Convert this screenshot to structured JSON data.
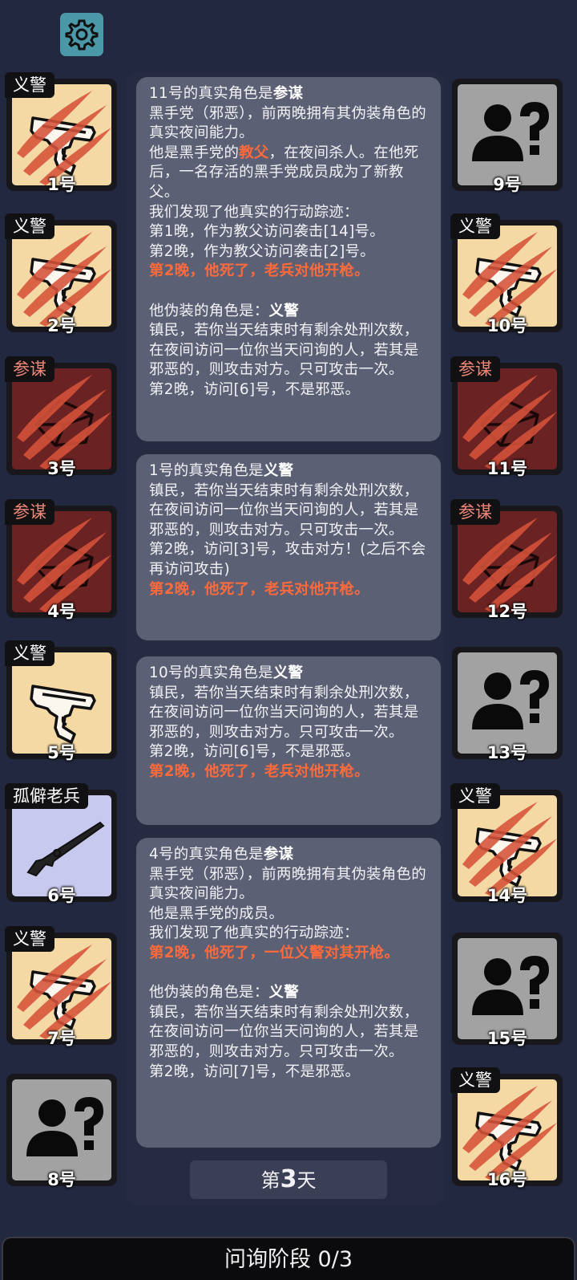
{
  "players": [
    {
      "number": "1号",
      "role": "义警",
      "role_color": "white",
      "face": "vig",
      "icon": "pistol-clawed-icon"
    },
    {
      "number": "2号",
      "role": "义警",
      "role_color": "white",
      "face": "vig",
      "icon": "pistol-clawed-icon"
    },
    {
      "number": "3号",
      "role": "参谋",
      "role_color": "red",
      "face": "con",
      "icon": "envelope-clawed-icon"
    },
    {
      "number": "4号",
      "role": "参谋",
      "role_color": "red",
      "face": "con",
      "icon": "envelope-clawed-icon"
    },
    {
      "number": "5号",
      "role": "义警",
      "role_color": "white",
      "face": "vig",
      "icon": "pistol-icon"
    },
    {
      "number": "6号",
      "role": "孤僻老兵",
      "role_color": "white",
      "face": "vet",
      "icon": "rifle-icon"
    },
    {
      "number": "7号",
      "role": "义警",
      "role_color": "white",
      "face": "vig",
      "icon": "pistol-clawed-icon"
    },
    {
      "number": "8号",
      "role": "",
      "role_color": "white",
      "face": "unk",
      "icon": "unknown-person-icon"
    },
    {
      "number": "9号",
      "role": "",
      "role_color": "white",
      "face": "unk",
      "icon": "unknown-person-icon"
    },
    {
      "number": "10号",
      "role": "义警",
      "role_color": "white",
      "face": "vig",
      "icon": "pistol-clawed-icon"
    },
    {
      "number": "11号",
      "role": "参谋",
      "role_color": "red",
      "face": "con",
      "icon": "envelope-clawed-icon"
    },
    {
      "number": "12号",
      "role": "参谋",
      "role_color": "red",
      "face": "con",
      "icon": "envelope-clawed-icon"
    },
    {
      "number": "13号",
      "role": "",
      "role_color": "white",
      "face": "unk",
      "icon": "unknown-person-icon"
    },
    {
      "number": "14号",
      "role": "义警",
      "role_color": "white",
      "face": "vig",
      "icon": "pistol-clawed-icon"
    },
    {
      "number": "15号",
      "role": "",
      "role_color": "white",
      "face": "unk",
      "icon": "unknown-person-icon"
    },
    {
      "number": "16号",
      "role": "义警",
      "role_color": "white",
      "face": "vig",
      "icon": "pistol-clawed-icon"
    }
  ],
  "messages": [
    {
      "lines": [
        {
          "text": "11号的真实角色是",
          "bold": "参谋"
        },
        {
          "text": "黑手党（邪恶），前两晚拥有其伪装角色的真实夜间能力。"
        },
        {
          "text": "他是黑手党的",
          "red": "教父",
          "after": "，在夜间杀人。在他死后，一名存活的黑手党成员成为了新教父。"
        },
        {
          "text": "我们发现了他真实的行动踪迹："
        },
        {
          "text": "第1晚，作为教父访问袭击[14]号。"
        },
        {
          "text": "第2晚，作为教父访问袭击[2]号。"
        },
        {
          "highlight": "第2晚，他死了，老兵对他开枪。"
        },
        {
          "text": ""
        },
        {
          "text": "他伪装的角色是：",
          "bold": "义警"
        },
        {
          "text": "镇民，若你当天结束时有剩余处刑次数，在夜间访问一位你当天问询的人，若其是邪恶的，则攻击对方。只可攻击一次。"
        },
        {
          "text": "第2晚，访问[6]号，不是邪恶。"
        }
      ]
    },
    {
      "lines": [
        {
          "text": "1号的真实角色是",
          "bold": "义警"
        },
        {
          "text": "镇民，若你当天结束时有剩余处刑次数，在夜间访问一位你当天问询的人，若其是邪恶的，则攻击对方。只可攻击一次。"
        },
        {
          "text": "第2晚，访问[3]号，攻击对方！(之后不会再访问攻击)"
        },
        {
          "highlight": "第2晚，他死了，老兵对他开枪。"
        }
      ]
    },
    {
      "lines": [
        {
          "text": "10号的真实角色是",
          "bold": "义警"
        },
        {
          "text": "镇民，若你当天结束时有剩余处刑次数，在夜间访问一位你当天问询的人，若其是邪恶的，则攻击对方。只可攻击一次。"
        },
        {
          "text": "第2晚，访问[6]号，不是邪恶。"
        },
        {
          "highlight": "第2晚，他死了，老兵对他开枪。"
        }
      ]
    },
    {
      "lines": [
        {
          "text": "4号的真实角色是",
          "bold": "参谋"
        },
        {
          "text": "黑手党（邪恶），前两晚拥有其伪装角色的真实夜间能力。"
        },
        {
          "text": "他是黑手党的成员。"
        },
        {
          "text": "我们发现了他真实的行动踪迹："
        },
        {
          "highlight": "第2晚，他死了，一位义警对其开枪。"
        },
        {
          "text": ""
        },
        {
          "text": "他伪装的角色是：",
          "bold": "义警"
        },
        {
          "text": "镇民，若你当天结束时有剩余处刑次数，在夜间访问一位你当天问询的人，若其是邪恶的，则攻击对方。只可攻击一次。"
        },
        {
          "text": "第2晚，访问[7]号，不是邪恶。"
        }
      ]
    }
  ],
  "day": {
    "prefix": "第",
    "number": "3",
    "suffix": "天"
  },
  "phase": "问询阶段 0/3",
  "colors": {
    "highlight": "#ff6a3c",
    "vigilante_bg": "#f4d9a4",
    "consigliere_bg": "#6a2222",
    "unknown_bg": "#a2a2a2",
    "veteran_bg": "#c8c9ee",
    "settings_bg": "#4a98a8"
  }
}
